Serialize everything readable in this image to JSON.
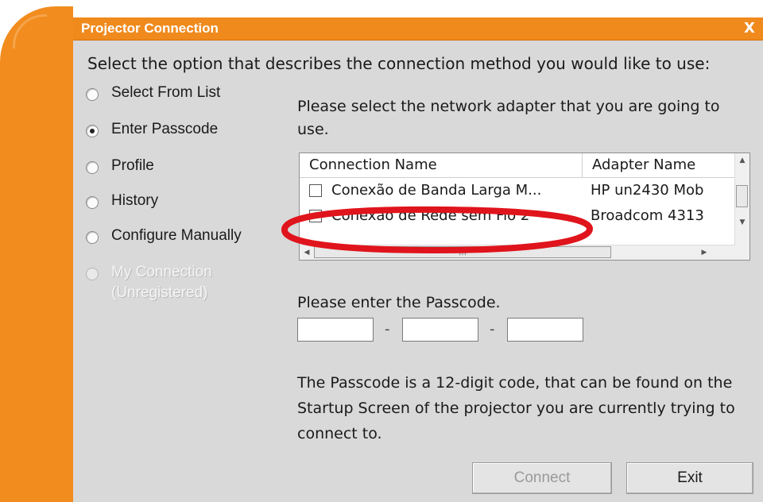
{
  "window": {
    "title": "Projector Connection",
    "close_glyph": "X",
    "accent_color": "#f08a1d"
  },
  "instruction": "Select the option that describes the connection method you would like to use:",
  "methods": [
    {
      "label": "Select From List",
      "selected": false,
      "enabled": true
    },
    {
      "label": "Enter Passcode",
      "selected": true,
      "enabled": true
    },
    {
      "label": "Profile",
      "selected": false,
      "enabled": true
    },
    {
      "label": "History",
      "selected": false,
      "enabled": true
    },
    {
      "label": "Configure Manually",
      "selected": false,
      "enabled": true
    },
    {
      "label": "My Connection",
      "sublabel": "(Unregistered)",
      "selected": false,
      "enabled": false
    }
  ],
  "adapter_prompt": "Please select the network adapter that you are going to use.",
  "adapter_list": {
    "columns": [
      "Connection Name",
      "Adapter Name"
    ],
    "rows": [
      {
        "connection": "Conexão de Banda Larga M...",
        "adapter": "HP un2430 Mob",
        "checked": false
      },
      {
        "connection": "Conexão de Rede sem Fio 2",
        "adapter": "Broadcom 4313",
        "checked": false
      }
    ],
    "annotation_color": "#e0141c"
  },
  "passcode": {
    "label": "Please enter the Passcode.",
    "separator": "-",
    "fields": [
      "",
      "",
      ""
    ]
  },
  "help_text": "The Passcode is a 12-digit code, that can be found on the Startup Screen of the projector you are currently trying to connect to.",
  "buttons": {
    "connect": {
      "label": "Connect",
      "enabled": false
    },
    "exit": {
      "label": "Exit",
      "enabled": true
    }
  }
}
